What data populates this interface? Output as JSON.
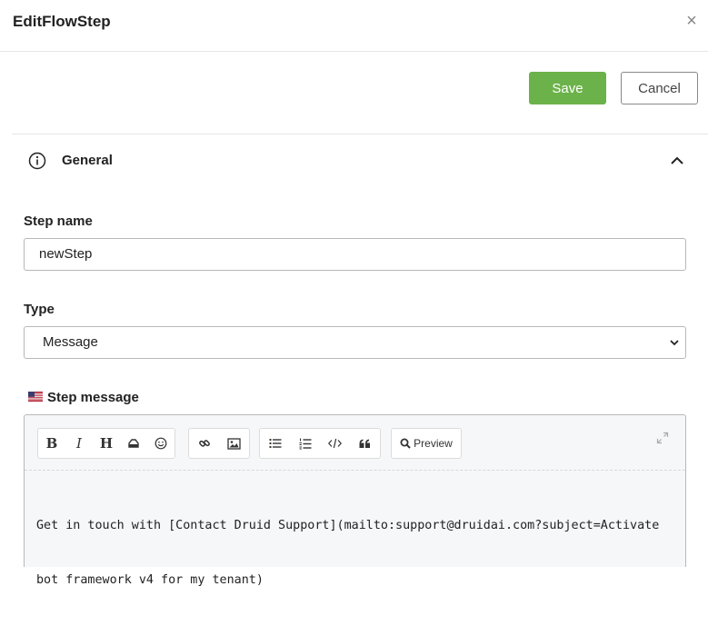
{
  "dialog": {
    "title": "EditFlowStep",
    "close_glyph": "×"
  },
  "actions": {
    "save_label": "Save",
    "cancel_label": "Cancel",
    "save_color": "#6cb24a"
  },
  "section": {
    "title": "General",
    "icon": "info-icon",
    "toggle_icon": "chevron-up-icon"
  },
  "fields": {
    "step_name": {
      "label": "Step name",
      "value": "newStep"
    },
    "type": {
      "label": "Type",
      "value": "Message"
    },
    "step_message": {
      "label": "Step message",
      "locale_icon": "us-flag-icon",
      "toolbar": {
        "bold": "B",
        "italic": "I",
        "heading": "H",
        "preview_label": "Preview"
      },
      "value_line1": "Get in touch with [Contact Druid Support](mailto:support@druidai.com?subject=Activate",
      "value_line2": "bot framework v4 for my tenant)"
    }
  }
}
